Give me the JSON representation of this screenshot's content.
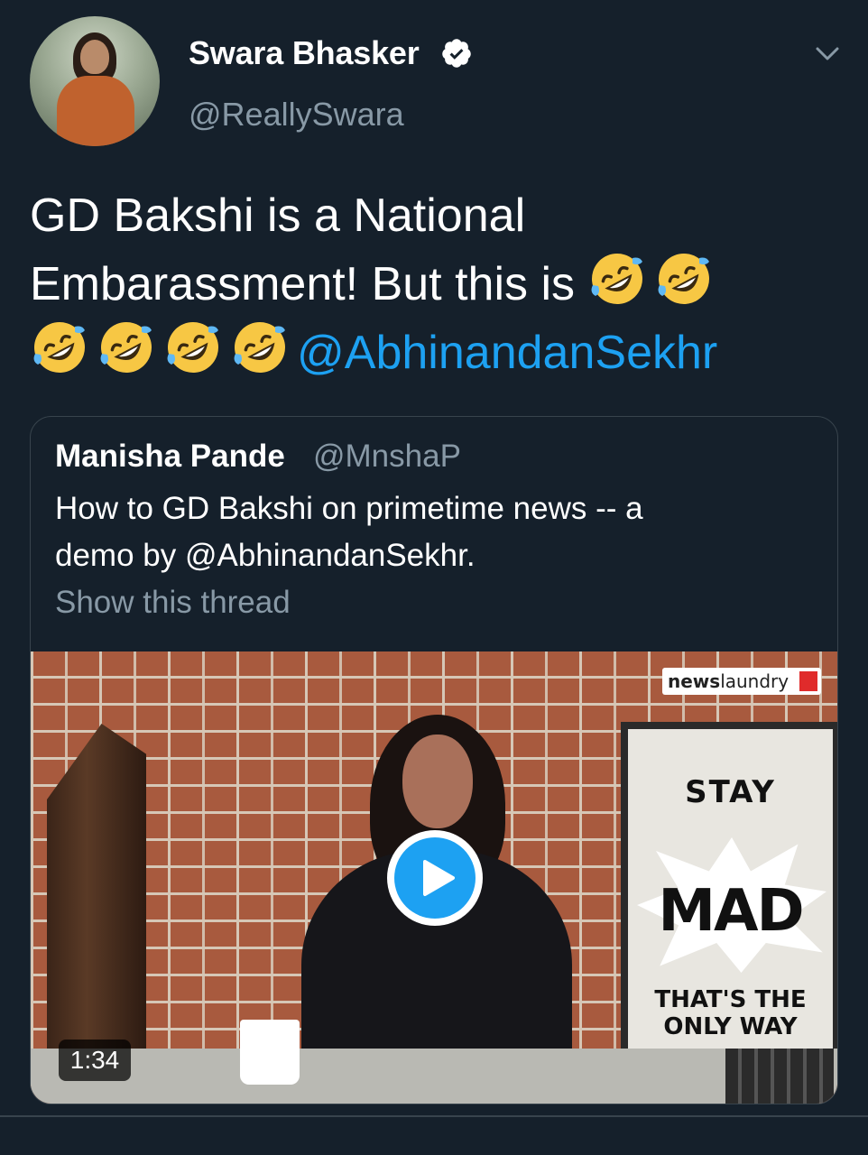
{
  "author": {
    "name": "Swara Bhasker",
    "handle": "@ReallySwara",
    "verified": true
  },
  "tweet": {
    "text_line1": "GD Bakshi is a National",
    "text_line2": "Embarassment! But this is",
    "emoji": "rolling-on-the-floor-laughing",
    "emoji_count": 6,
    "mention": "@AbhinandanSekhr"
  },
  "quoted_tweet": {
    "name": "Manisha Pande",
    "handle": "@MnshaP",
    "text_line1": "How to GD Bakshi on primetime news -- a",
    "text_line2": "demo by @AbhinandanSekhr.",
    "show_thread": "Show this thread",
    "video": {
      "duration": "1:34",
      "watermark_bold": "news",
      "watermark_rest": "laundry",
      "poster_top": "STAY",
      "poster_middle": "MAD",
      "poster_bottom_1": "THAT'S THE",
      "poster_bottom_2": "ONLY WAY"
    }
  },
  "icons": [
    "verified-badge-icon",
    "chevron-down-icon",
    "play-icon"
  ],
  "colors": {
    "background": "#15202b",
    "accent": "#1da1f2",
    "secondary_text": "#8899a6",
    "border": "#38444d"
  }
}
